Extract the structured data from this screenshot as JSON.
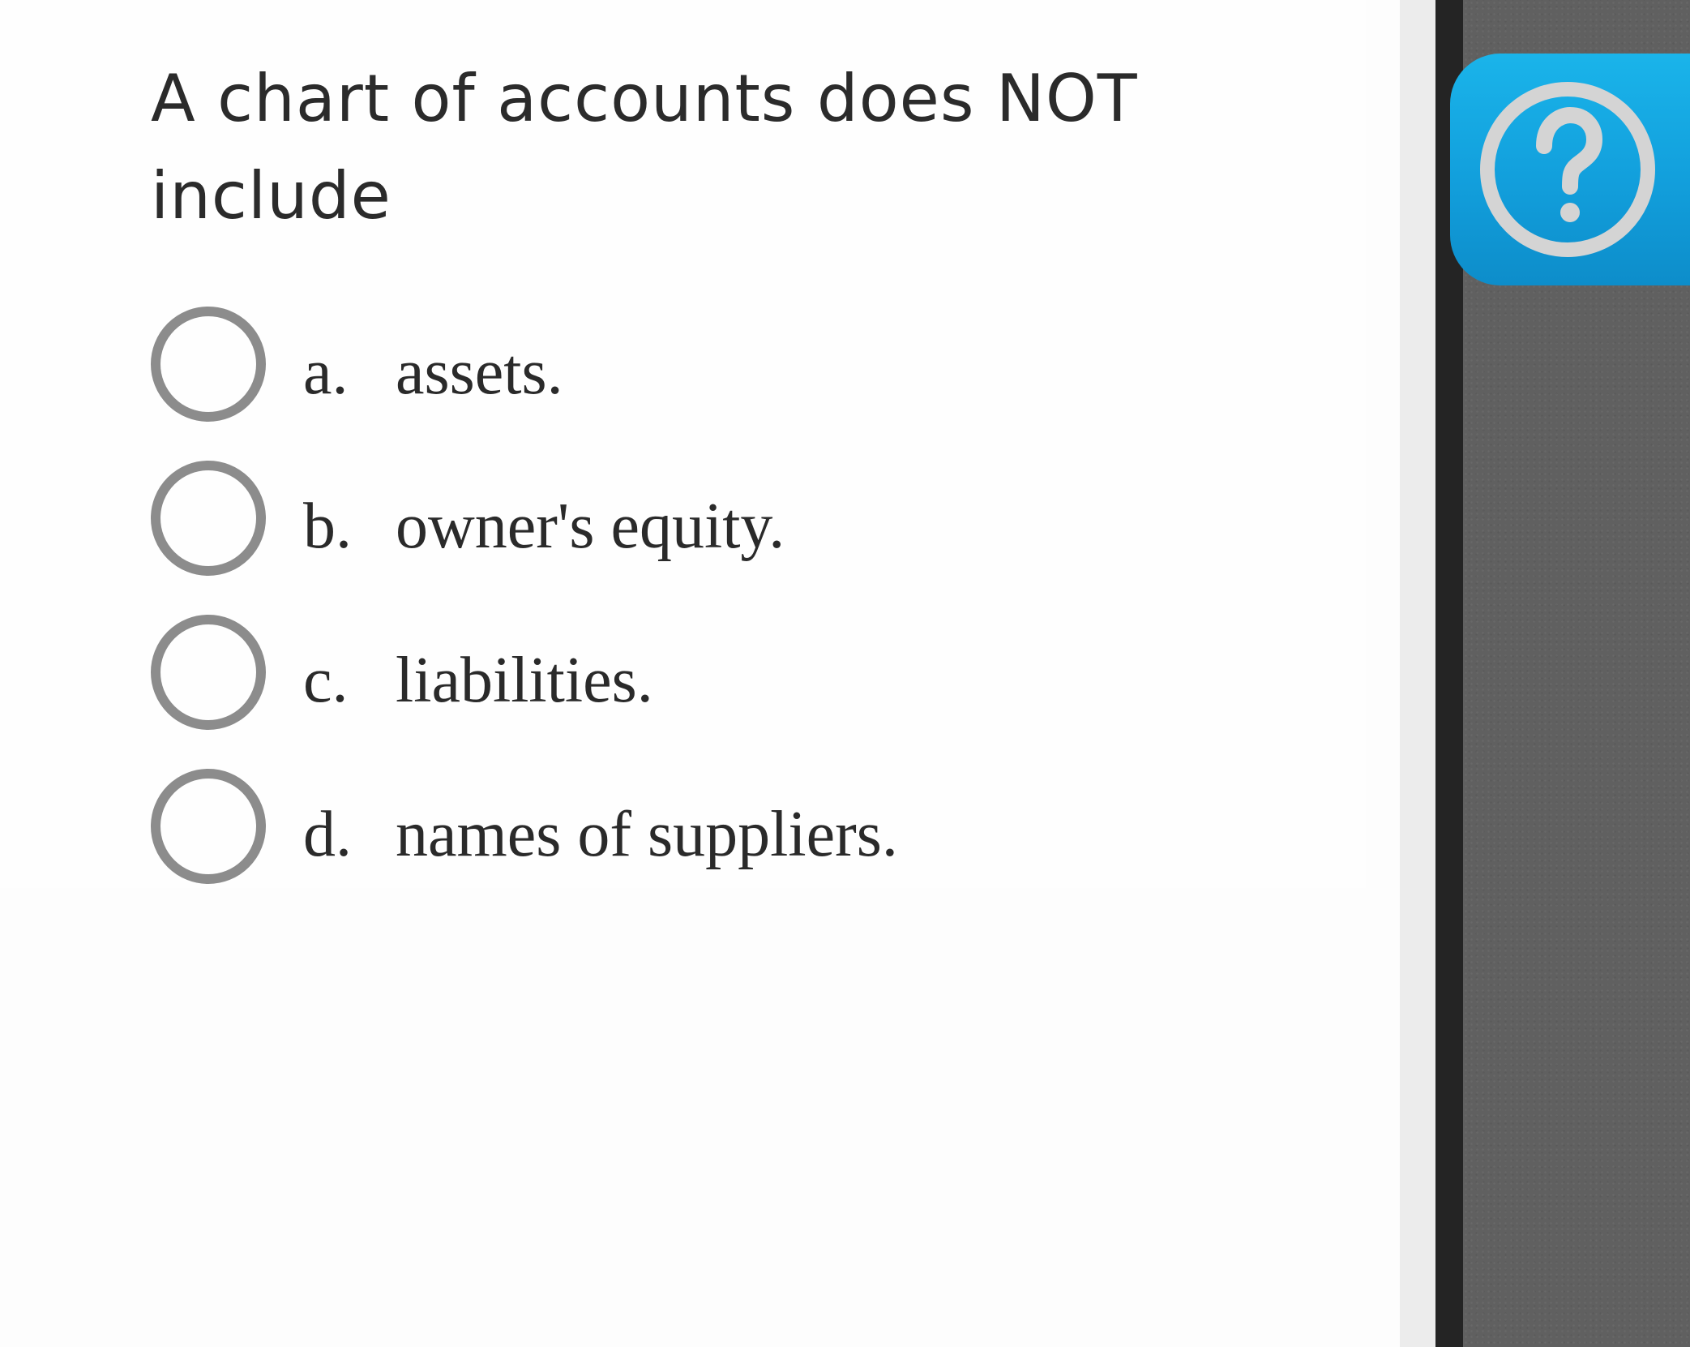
{
  "question": {
    "text": "A chart of accounts does NOT include"
  },
  "options": [
    {
      "letter": "a.",
      "text": "assets."
    },
    {
      "letter": "b.",
      "text": "owner's equity."
    },
    {
      "letter": "c.",
      "text": "liabilities."
    },
    {
      "letter": "d.",
      "text": "names of suppliers."
    }
  ],
  "help_button": {
    "icon": "question-mark-icon"
  },
  "colors": {
    "accent_blue": "#14a9e3",
    "radio_border": "#8c8c8c",
    "text": "#2a2a2a",
    "side_panel": "#606060"
  }
}
